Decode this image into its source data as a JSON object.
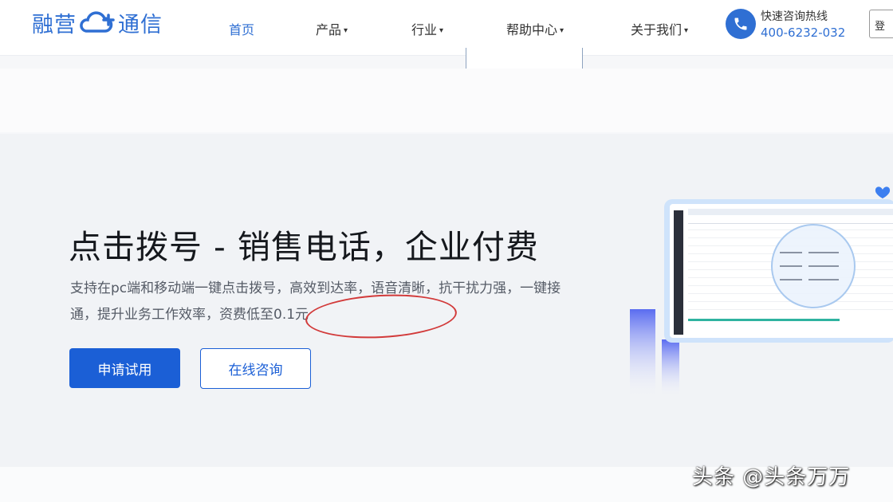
{
  "brand": {
    "name_left": "融营",
    "name_right": "通信",
    "accent_color": "#2f6fd3",
    "icon": "cloud-plus-icon"
  },
  "nav": [
    {
      "label": "首页",
      "active": true,
      "has_caret": false
    },
    {
      "label": "产品",
      "active": false,
      "has_caret": true
    },
    {
      "label": "行业",
      "active": false,
      "has_caret": true
    },
    {
      "label": "帮助中心",
      "active": false,
      "has_caret": true
    },
    {
      "label": "关于我们",
      "active": false,
      "has_caret": true
    }
  ],
  "hotline": {
    "label": "快速咨询热线",
    "number": "400-6232-032",
    "icon": "phone-icon"
  },
  "header_edge_button": "登",
  "hero": {
    "title": "点击拨号 - 销售电话，企业付费",
    "description": "支持在pc端和移动端一键点击拨号，高效到达率，语音清晰，抗干扰力强，一键接通，提升业务工作效率，",
    "price_highlight": "资费低至0.1元",
    "highlight_color": "#d23a3a",
    "primary_button": "申请试用",
    "secondary_button": "在线咨询",
    "button_color": "#1b5fd6"
  },
  "watermark": "头条 @头条万万"
}
